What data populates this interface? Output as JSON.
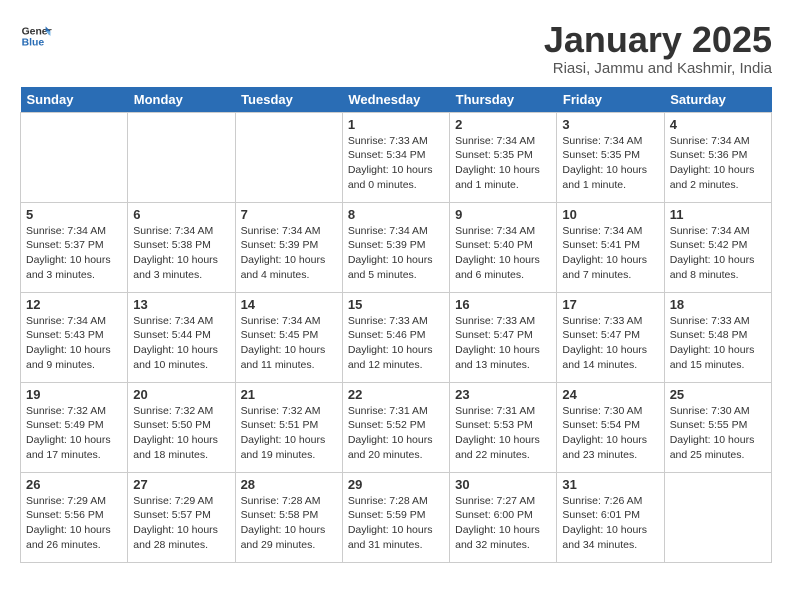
{
  "header": {
    "logo_line1": "General",
    "logo_line2": "Blue",
    "title": "January 2025",
    "subtitle": "Riasi, Jammu and Kashmir, India"
  },
  "days_of_week": [
    "Sunday",
    "Monday",
    "Tuesday",
    "Wednesday",
    "Thursday",
    "Friday",
    "Saturday"
  ],
  "weeks": [
    [
      {
        "day": "",
        "info": ""
      },
      {
        "day": "",
        "info": ""
      },
      {
        "day": "",
        "info": ""
      },
      {
        "day": "1",
        "info": "Sunrise: 7:33 AM\nSunset: 5:34 PM\nDaylight: 10 hours\nand 0 minutes."
      },
      {
        "day": "2",
        "info": "Sunrise: 7:34 AM\nSunset: 5:35 PM\nDaylight: 10 hours\nand 1 minute."
      },
      {
        "day": "3",
        "info": "Sunrise: 7:34 AM\nSunset: 5:35 PM\nDaylight: 10 hours\nand 1 minute."
      },
      {
        "day": "4",
        "info": "Sunrise: 7:34 AM\nSunset: 5:36 PM\nDaylight: 10 hours\nand 2 minutes."
      }
    ],
    [
      {
        "day": "5",
        "info": "Sunrise: 7:34 AM\nSunset: 5:37 PM\nDaylight: 10 hours\nand 3 minutes."
      },
      {
        "day": "6",
        "info": "Sunrise: 7:34 AM\nSunset: 5:38 PM\nDaylight: 10 hours\nand 3 minutes."
      },
      {
        "day": "7",
        "info": "Sunrise: 7:34 AM\nSunset: 5:39 PM\nDaylight: 10 hours\nand 4 minutes."
      },
      {
        "day": "8",
        "info": "Sunrise: 7:34 AM\nSunset: 5:39 PM\nDaylight: 10 hours\nand 5 minutes."
      },
      {
        "day": "9",
        "info": "Sunrise: 7:34 AM\nSunset: 5:40 PM\nDaylight: 10 hours\nand 6 minutes."
      },
      {
        "day": "10",
        "info": "Sunrise: 7:34 AM\nSunset: 5:41 PM\nDaylight: 10 hours\nand 7 minutes."
      },
      {
        "day": "11",
        "info": "Sunrise: 7:34 AM\nSunset: 5:42 PM\nDaylight: 10 hours\nand 8 minutes."
      }
    ],
    [
      {
        "day": "12",
        "info": "Sunrise: 7:34 AM\nSunset: 5:43 PM\nDaylight: 10 hours\nand 9 minutes."
      },
      {
        "day": "13",
        "info": "Sunrise: 7:34 AM\nSunset: 5:44 PM\nDaylight: 10 hours\nand 10 minutes."
      },
      {
        "day": "14",
        "info": "Sunrise: 7:34 AM\nSunset: 5:45 PM\nDaylight: 10 hours\nand 11 minutes."
      },
      {
        "day": "15",
        "info": "Sunrise: 7:33 AM\nSunset: 5:46 PM\nDaylight: 10 hours\nand 12 minutes."
      },
      {
        "day": "16",
        "info": "Sunrise: 7:33 AM\nSunset: 5:47 PM\nDaylight: 10 hours\nand 13 minutes."
      },
      {
        "day": "17",
        "info": "Sunrise: 7:33 AM\nSunset: 5:47 PM\nDaylight: 10 hours\nand 14 minutes."
      },
      {
        "day": "18",
        "info": "Sunrise: 7:33 AM\nSunset: 5:48 PM\nDaylight: 10 hours\nand 15 minutes."
      }
    ],
    [
      {
        "day": "19",
        "info": "Sunrise: 7:32 AM\nSunset: 5:49 PM\nDaylight: 10 hours\nand 17 minutes."
      },
      {
        "day": "20",
        "info": "Sunrise: 7:32 AM\nSunset: 5:50 PM\nDaylight: 10 hours\nand 18 minutes."
      },
      {
        "day": "21",
        "info": "Sunrise: 7:32 AM\nSunset: 5:51 PM\nDaylight: 10 hours\nand 19 minutes."
      },
      {
        "day": "22",
        "info": "Sunrise: 7:31 AM\nSunset: 5:52 PM\nDaylight: 10 hours\nand 20 minutes."
      },
      {
        "day": "23",
        "info": "Sunrise: 7:31 AM\nSunset: 5:53 PM\nDaylight: 10 hours\nand 22 minutes."
      },
      {
        "day": "24",
        "info": "Sunrise: 7:30 AM\nSunset: 5:54 PM\nDaylight: 10 hours\nand 23 minutes."
      },
      {
        "day": "25",
        "info": "Sunrise: 7:30 AM\nSunset: 5:55 PM\nDaylight: 10 hours\nand 25 minutes."
      }
    ],
    [
      {
        "day": "26",
        "info": "Sunrise: 7:29 AM\nSunset: 5:56 PM\nDaylight: 10 hours\nand 26 minutes."
      },
      {
        "day": "27",
        "info": "Sunrise: 7:29 AM\nSunset: 5:57 PM\nDaylight: 10 hours\nand 28 minutes."
      },
      {
        "day": "28",
        "info": "Sunrise: 7:28 AM\nSunset: 5:58 PM\nDaylight: 10 hours\nand 29 minutes."
      },
      {
        "day": "29",
        "info": "Sunrise: 7:28 AM\nSunset: 5:59 PM\nDaylight: 10 hours\nand 31 minutes."
      },
      {
        "day": "30",
        "info": "Sunrise: 7:27 AM\nSunset: 6:00 PM\nDaylight: 10 hours\nand 32 minutes."
      },
      {
        "day": "31",
        "info": "Sunrise: 7:26 AM\nSunset: 6:01 PM\nDaylight: 10 hours\nand 34 minutes."
      },
      {
        "day": "",
        "info": ""
      }
    ]
  ]
}
